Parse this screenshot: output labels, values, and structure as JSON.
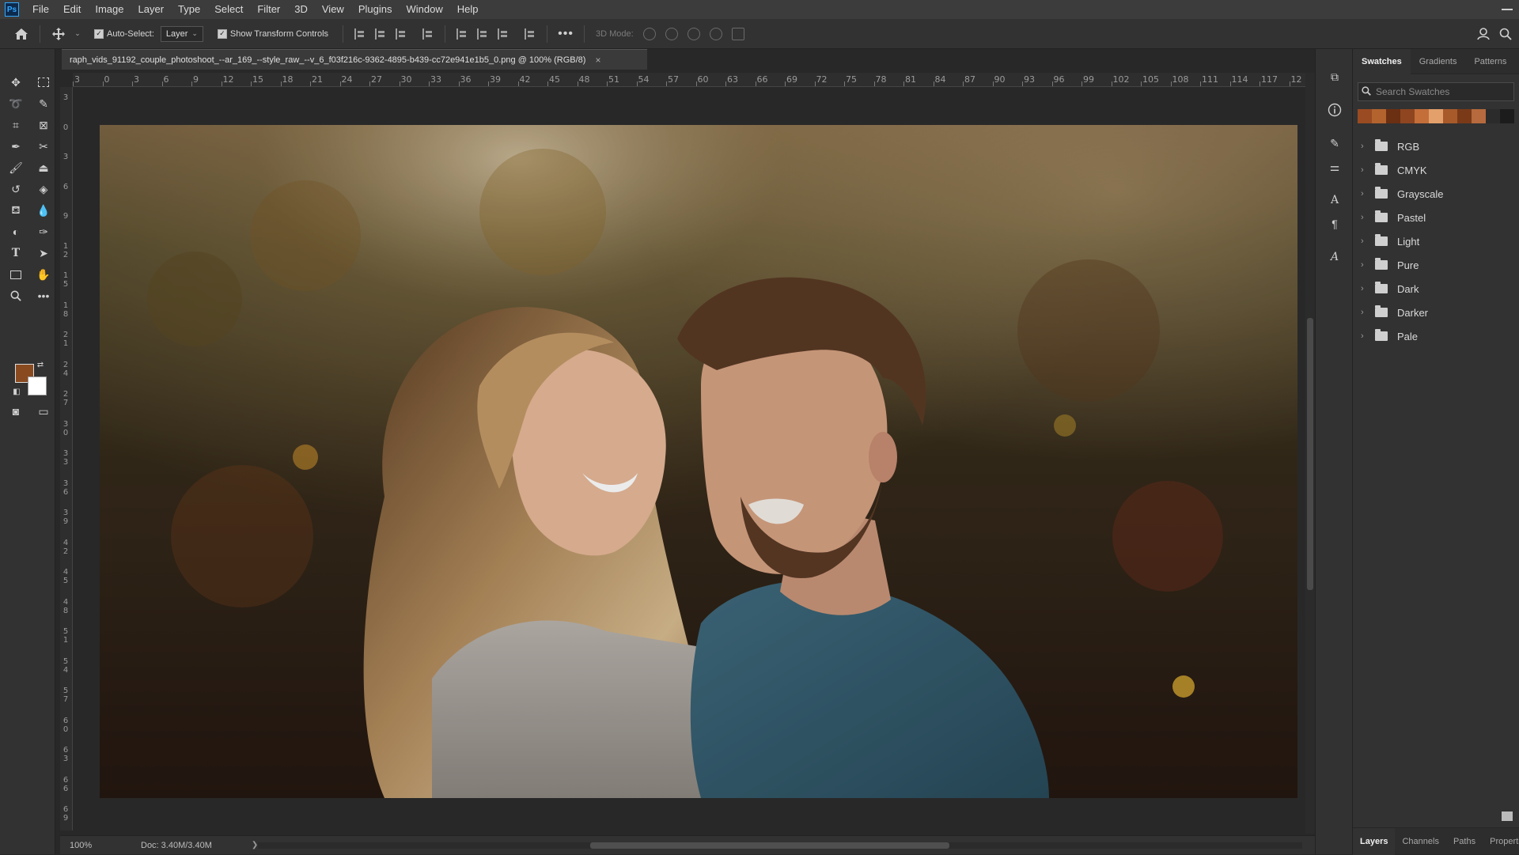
{
  "menubar": {
    "logo": "Ps",
    "items": [
      "File",
      "Edit",
      "Image",
      "Layer",
      "Type",
      "Select",
      "Filter",
      "3D",
      "View",
      "Plugins",
      "Window",
      "Help"
    ]
  },
  "options": {
    "auto_select_label": "Auto-Select:",
    "layer_select_value": "Layer",
    "show_transform_label": "Show Transform Controls",
    "mode_3d_label": "3D Mode:"
  },
  "document": {
    "tab_title": "raph_vids_91192_couple_photoshoot_--ar_169_--style_raw_--v_6_f03f216c-9362-4895-b439-cc72e941e1b5_0.png @ 100% (RGB/8)",
    "close_glyph": "×"
  },
  "ruler": {
    "top_labels": [
      "3",
      "0",
      "3",
      "6",
      "9",
      "12",
      "15",
      "18",
      "21",
      "24",
      "27",
      "30",
      "33",
      "36",
      "39",
      "42",
      "45",
      "48",
      "51",
      "54",
      "57",
      "60",
      "63",
      "66",
      "69",
      "72",
      "75",
      "78",
      "81",
      "84",
      "87",
      "90",
      "93",
      "96",
      "99",
      "102",
      "105",
      "108",
      "111",
      "114",
      "117",
      "12"
    ],
    "left_labels": [
      "3",
      "0",
      "3",
      "6",
      "9",
      "1 2",
      "1 5",
      "1 8",
      "2 1",
      "2 4",
      "2 7",
      "3 0",
      "3 3",
      "3 6",
      "3 9",
      "4 2",
      "4 5",
      "4 8",
      "5 1",
      "5 4",
      "5 7",
      "6 0",
      "6 3",
      "6 6",
      "6 9"
    ]
  },
  "status": {
    "zoom": "100%",
    "doc_info": "Doc: 3.40M/3.40M",
    "arrow": "❯"
  },
  "colors": {
    "foreground": "#8a4a1f",
    "background": "#ffffff",
    "accent": "#31a8ff"
  },
  "panel": {
    "tabs": [
      "Swatches",
      "Gradients",
      "Patterns"
    ],
    "active_tab": "Swatches",
    "search_placeholder": "Search Swatches",
    "recent_swatches": [
      "#9a4b22",
      "#b3632e",
      "#6b2f12",
      "#8e4520",
      "#c46e3a",
      "#e3a06b",
      "#a85a2b",
      "#7a3a18",
      "#b66a3d",
      "#2b2b2b",
      "#1c1c1c"
    ],
    "groups": [
      "RGB",
      "CMYK",
      "Grayscale",
      "Pastel",
      "Light",
      "Pure",
      "Dark",
      "Darker",
      "Pale"
    ],
    "bottom_tabs": [
      "Layers",
      "Channels",
      "Paths",
      "Properties"
    ],
    "bottom_active": "Layers"
  }
}
